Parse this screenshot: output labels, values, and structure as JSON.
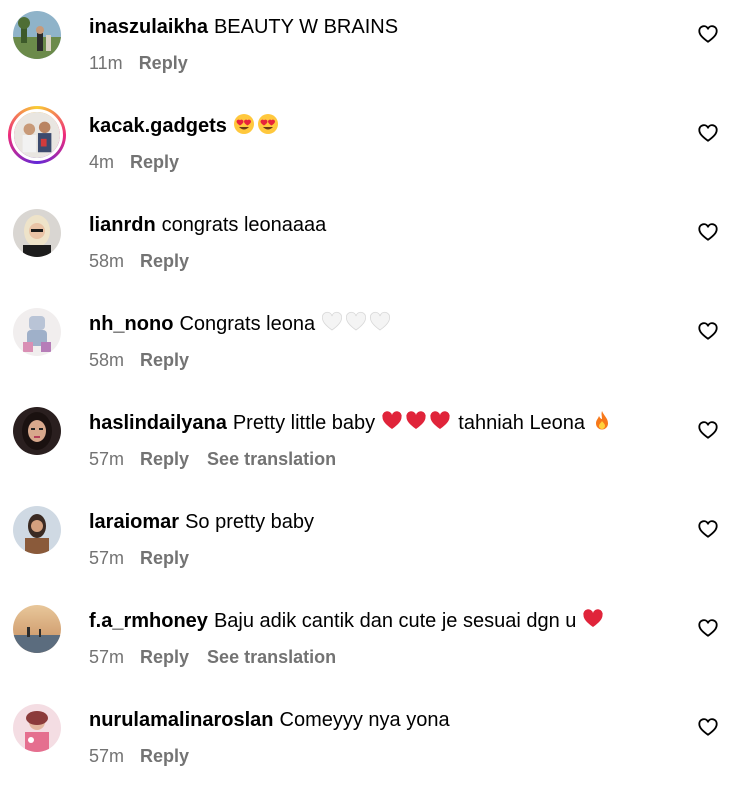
{
  "comments": [
    {
      "username": "inaszulaikha",
      "text": "BEAUTY W BRAINS",
      "emojis": [],
      "time": "11m",
      "reply": "Reply",
      "see_translation": "",
      "avatar": "outdoor-photo-avatar",
      "avatar_story_ring": false,
      "like_icon": "heart-outline-icon"
    },
    {
      "username": "kacak.gadgets",
      "text": "",
      "emojis": [
        "heart-eyes-emoji",
        "heart-eyes-emoji"
      ],
      "time": "4m",
      "reply": "Reply",
      "see_translation": "",
      "avatar": "people-photo-avatar",
      "avatar_story_ring": true,
      "like_icon": "heart-outline-icon"
    },
    {
      "username": "lianrdn",
      "text": "congrats leonaaaa",
      "emojis": [],
      "time": "58m",
      "reply": "Reply",
      "see_translation": "",
      "avatar": "blonde-person-avatar",
      "avatar_story_ring": false,
      "like_icon": "heart-outline-icon"
    },
    {
      "username": "nh_nono",
      "text": "Congrats leona",
      "emojis": [
        "white-heart-emoji",
        "white-heart-emoji",
        "white-heart-emoji"
      ],
      "time": "58m",
      "reply": "Reply",
      "see_translation": "",
      "avatar": "toy-photo-avatar",
      "avatar_story_ring": false,
      "like_icon": "heart-outline-icon"
    },
    {
      "username": "haslindailyana",
      "text": "Pretty little baby",
      "emojis": [
        "red-heart-emoji",
        "red-heart-emoji",
        "red-heart-emoji"
      ],
      "text_after": "tahniah Leona",
      "emojis_after": [
        "fire-emoji"
      ],
      "time": "57m",
      "reply": "Reply",
      "see_translation": "See translation",
      "avatar": "dark-hair-person-avatar",
      "avatar_story_ring": false,
      "like_icon": "heart-outline-icon"
    },
    {
      "username": "laraiomar",
      "text": "So pretty baby",
      "emojis": [],
      "time": "57m",
      "reply": "Reply",
      "see_translation": "",
      "avatar": "person-portrait-avatar",
      "avatar_story_ring": false,
      "like_icon": "heart-outline-icon"
    },
    {
      "username": "f.a_rmhoney",
      "text": "Baju adik cantik dan cute je sesuai dgn u",
      "emojis": [
        "red-heart-emoji"
      ],
      "time": "57m",
      "reply": "Reply",
      "see_translation": "See translation",
      "avatar": "sunset-landscape-avatar",
      "avatar_story_ring": false,
      "like_icon": "heart-outline-icon"
    },
    {
      "username": "nurulamalinaroslan",
      "text": "Comeyyy nya yona",
      "emojis": [],
      "time": "57m",
      "reply": "Reply",
      "see_translation": "",
      "avatar": "pink-photo-avatar",
      "avatar_story_ring": false,
      "like_icon": "heart-outline-icon"
    }
  ],
  "colors": {
    "text": "#000000",
    "meta": "#737373",
    "background": "#ffffff",
    "story_ring": [
      "#f9ce34",
      "#ee2a7b",
      "#6228d7"
    ]
  }
}
